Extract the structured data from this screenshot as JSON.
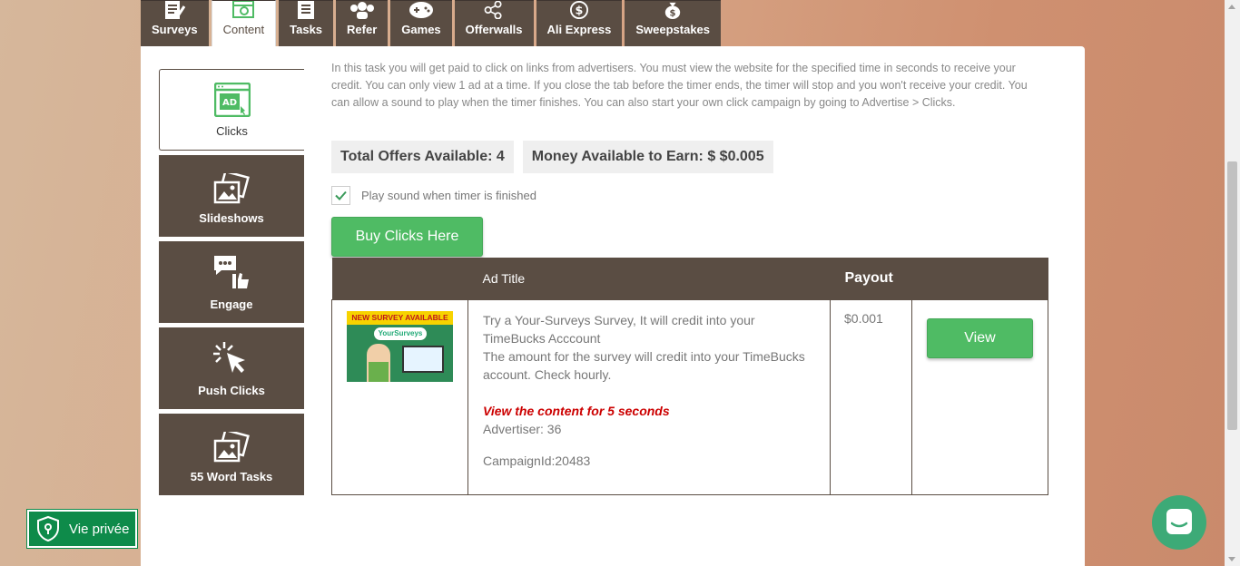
{
  "top_tabs": [
    {
      "label": "Surveys",
      "icon": "survey-icon"
    },
    {
      "label": "Content",
      "icon": "content-icon"
    },
    {
      "label": "Tasks",
      "icon": "tasks-icon"
    },
    {
      "label": "Refer",
      "icon": "refer-icon"
    },
    {
      "label": "Games",
      "icon": "gamepad-icon"
    },
    {
      "label": "Offerwalls",
      "icon": "share-icon"
    },
    {
      "label": "Ali Express",
      "icon": "dollar-circle-icon"
    },
    {
      "label": "Sweepstakes",
      "icon": "money-bag-icon"
    }
  ],
  "sidebar": {
    "items": [
      {
        "label": "Clicks",
        "icon": "ad-icon"
      },
      {
        "label": "Slideshows",
        "icon": "images-icon"
      },
      {
        "label": "Engage",
        "icon": "engage-icon"
      },
      {
        "label": "Push Clicks",
        "icon": "cursor-click-icon"
      },
      {
        "label": "55 Word Tasks",
        "icon": "images-icon"
      }
    ]
  },
  "main": {
    "description": "In this task you will get paid to click on links from advertisers. You must view the website for the specified time in seconds to receive your credit. You can only view 1 ad at a time. If you close the tab before the timer ends, the timer will stop and you won't receive your credit. You can allow a sound to play when the timer finishes. You can also start your own click campaign by going to Advertise > Clicks.",
    "total_offers": "Total Offers Available: 4",
    "money_available": "Money Available to Earn: $ $0.005",
    "sound_label": "Play sound when timer is finished",
    "sound_checked": true,
    "buy_button": "Buy Clicks Here",
    "table": {
      "headers": [
        "",
        "Ad Title",
        "Payout",
        ""
      ],
      "rows": [
        {
          "thumb_banner": "NEW SURVEY AVAILABLE",
          "thumb_logo": "YourSurveys",
          "title_line1": "Try a Your-Surveys Survey, It will credit into your TimeBucks Acccount",
          "title_line2": "The amount for the survey will credit into your TimeBucks account. Check hourly.",
          "view_note": "View the content for 5 seconds",
          "advertiser": "Advertiser: 36",
          "campaign": "CampaignId:20483",
          "payout": "$0.001",
          "view_button": "View"
        }
      ]
    }
  },
  "privacy_button": "Vie privée",
  "colors": {
    "brown": "#5a4d43",
    "green": "#4fbb64",
    "privacy_green": "#0e8b4a",
    "chat_green": "#3daa77",
    "note_red": "#cc0000"
  }
}
